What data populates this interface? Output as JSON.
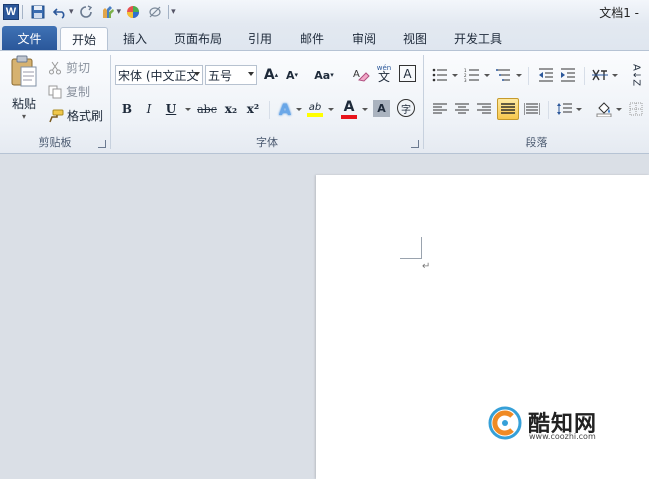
{
  "window": {
    "title": "文档1 -"
  },
  "qat": {
    "app_icon_letter": "W"
  },
  "tabs": {
    "file": "文件",
    "items": [
      "开始",
      "插入",
      "页面布局",
      "引用",
      "邮件",
      "审阅",
      "视图",
      "开发工具"
    ],
    "active": "开始"
  },
  "clipboard": {
    "group_label": "剪贴板",
    "paste": "粘贴",
    "cut": "剪切",
    "copy": "复制",
    "format_painter": "格式刷"
  },
  "font": {
    "group_label": "字体",
    "font_name": "宋体 (中文正文",
    "font_size": "五号",
    "grow": "A",
    "shrink": "A",
    "change_case": "Aa",
    "bold": "B",
    "italic": "I",
    "underline": "U",
    "strikethrough": "abc",
    "subscript": "x₂",
    "superscript": "x²",
    "text_effect": "A",
    "highlight": "ab",
    "font_color": "A",
    "char_shading": "A",
    "enclose": "字",
    "phonetic": "文",
    "phonetic_small": "wén",
    "border_char": "A"
  },
  "paragraph": {
    "group_label": "段落",
    "sort": "A↓Z"
  },
  "colors": {
    "file_tab": "#2a579a",
    "highlight_yellow": "#ffff00",
    "font_red": "#e8141b",
    "ribbon_bg": "#eef2f7",
    "doc_bg": "#dadfe6"
  },
  "watermark": {
    "name": "酷知网",
    "url": "www.coozhi.com"
  }
}
